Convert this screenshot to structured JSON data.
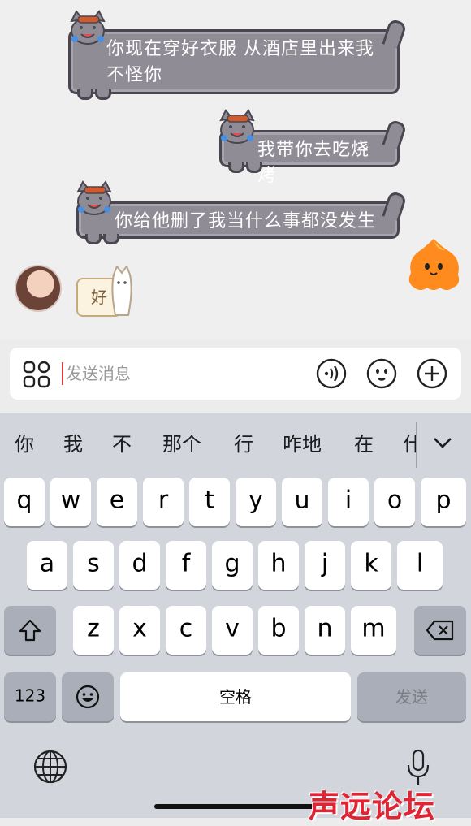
{
  "messages": [
    {
      "text": "你现在穿好衣服 从酒店里出来我\n不怪你"
    },
    {
      "text": "我带你去吃烧烤"
    },
    {
      "text": "你给他删了我当什么事都没发生"
    }
  ],
  "sticker_reply": {
    "text": "好"
  },
  "input": {
    "placeholder": "发送消息"
  },
  "candidates": [
    "你",
    "我",
    "不",
    "那个",
    "行",
    "咋地",
    "在",
    "什"
  ],
  "keyboard": {
    "row1": [
      "q",
      "w",
      "e",
      "r",
      "t",
      "y",
      "u",
      "i",
      "o",
      "p"
    ],
    "row2": [
      "a",
      "s",
      "d",
      "f",
      "g",
      "h",
      "j",
      "k",
      "l"
    ],
    "row3": [
      "z",
      "x",
      "c",
      "v",
      "b",
      "n",
      "m"
    ],
    "numbers_label": "123",
    "space_label": "空格",
    "send_label": "发送"
  },
  "watermark": "声远论坛",
  "colors": {
    "bubble": "#8f8c95",
    "bubble_border": "#4a4650",
    "caret": "#e03a3a",
    "watermark": "#e12434",
    "mascot": "#ff8a1e"
  },
  "icons": [
    "cat-sticker-icon",
    "grid-apps-icon",
    "voice-icon",
    "emoji-icon",
    "plus-icon",
    "chevron-down-icon",
    "shift-icon",
    "backspace-icon",
    "emoji-key-icon",
    "globe-icon",
    "mic-icon"
  ]
}
